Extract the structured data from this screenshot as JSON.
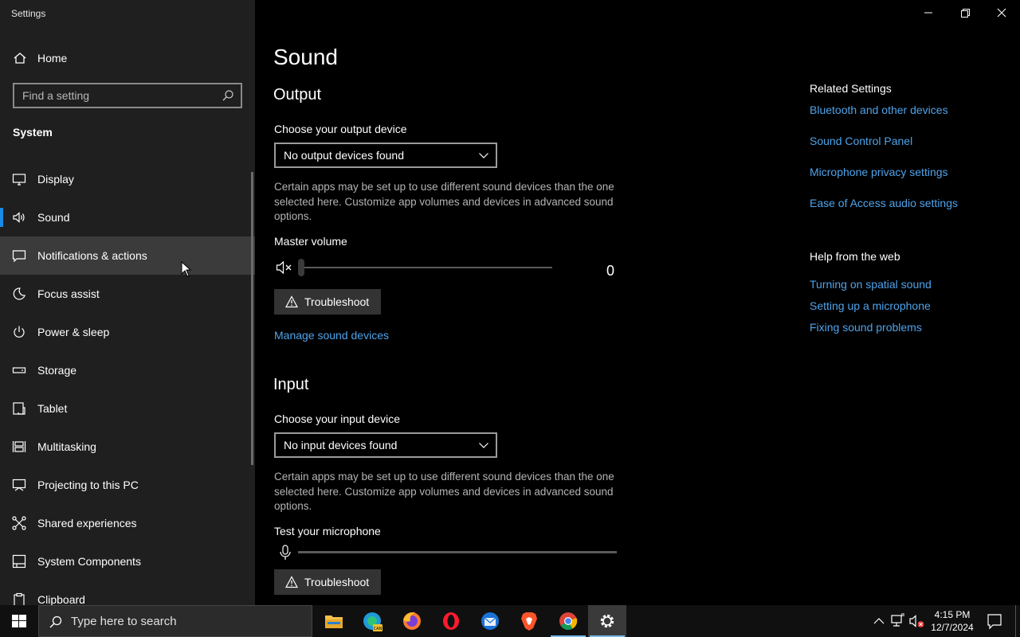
{
  "window": {
    "title": "Settings"
  },
  "sidebar": {
    "home_label": "Home",
    "search_placeholder": "Find a setting",
    "section_label": "System",
    "items": [
      {
        "label": "Display",
        "icon": "monitor-icon"
      },
      {
        "label": "Sound",
        "icon": "speaker-icon",
        "selected": true
      },
      {
        "label": "Notifications & actions",
        "icon": "notification-icon",
        "hovered": true
      },
      {
        "label": "Focus assist",
        "icon": "moon-icon"
      },
      {
        "label": "Power & sleep",
        "icon": "power-icon"
      },
      {
        "label": "Storage",
        "icon": "storage-icon"
      },
      {
        "label": "Tablet",
        "icon": "tablet-icon"
      },
      {
        "label": "Multitasking",
        "icon": "multitasking-icon"
      },
      {
        "label": "Projecting to this PC",
        "icon": "projecting-icon"
      },
      {
        "label": "Shared experiences",
        "icon": "shared-experiences-icon"
      },
      {
        "label": "System Components",
        "icon": "components-icon"
      },
      {
        "label": "Clipboard",
        "icon": "clipboard-icon"
      }
    ]
  },
  "main": {
    "title": "Sound",
    "output": {
      "heading": "Output",
      "device_label": "Choose your output device",
      "device_value": "No output devices found",
      "description": "Certain apps may be set up to use different sound devices than the one selected here. Customize app volumes and devices in advanced sound options.",
      "volume_label": "Master volume",
      "volume_value": "0",
      "volume_level": 0,
      "troubleshoot_label": "Troubleshoot",
      "manage_link": "Manage sound devices"
    },
    "input": {
      "heading": "Input",
      "device_label": "Choose your input device",
      "device_value": "No input devices found",
      "description": "Certain apps may be set up to use different sound devices than the one selected here. Customize app volumes and devices in advanced sound options.",
      "test_label": "Test your microphone",
      "mic_level": 0,
      "troubleshoot_label": "Troubleshoot"
    },
    "related": {
      "heading": "Related Settings",
      "links": [
        "Bluetooth and other devices",
        "Sound Control Panel",
        "Microphone privacy settings",
        "Ease of Access audio settings"
      ]
    },
    "help": {
      "heading": "Help from the web",
      "links": [
        "Turning on spatial sound",
        "Setting up a microphone",
        "Fixing sound problems"
      ]
    }
  },
  "taskbar": {
    "search_placeholder": "Type here to search",
    "apps": [
      "file-explorer-icon",
      "edge-canary-icon",
      "firefox-icon",
      "opera-icon",
      "thunderbird-icon",
      "brave-icon",
      "chrome-icon",
      "settings-gear-icon"
    ],
    "time": "4:15 PM",
    "date": "12/7/2024"
  },
  "colors": {
    "accent": "#1a8ae6",
    "link": "#4ea3ea",
    "sidebar_bg": "#1f1f1f",
    "hover_bg": "#3b3b3b"
  }
}
